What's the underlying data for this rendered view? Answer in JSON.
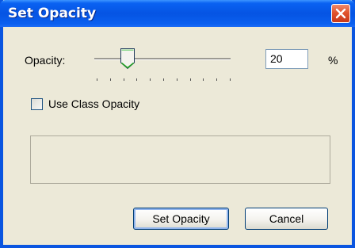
{
  "window": {
    "title": "Set Opacity",
    "close_icon": "close-icon"
  },
  "opacity": {
    "label": "Opacity:",
    "value": "20",
    "unit": "%",
    "slider_fraction": 0.2,
    "tick_count": 11
  },
  "use_class_opacity": {
    "label": "Use Class Opacity",
    "checked": false
  },
  "info_box": {
    "text": ""
  },
  "buttons": {
    "set_opacity": "Set Opacity",
    "cancel": "Cancel"
  },
  "colors": {
    "titlebar": "#0554e3",
    "close_button": "#e1542d",
    "dialog_background": "#ece9d8",
    "slider_thumb_accent": "#21a121"
  }
}
